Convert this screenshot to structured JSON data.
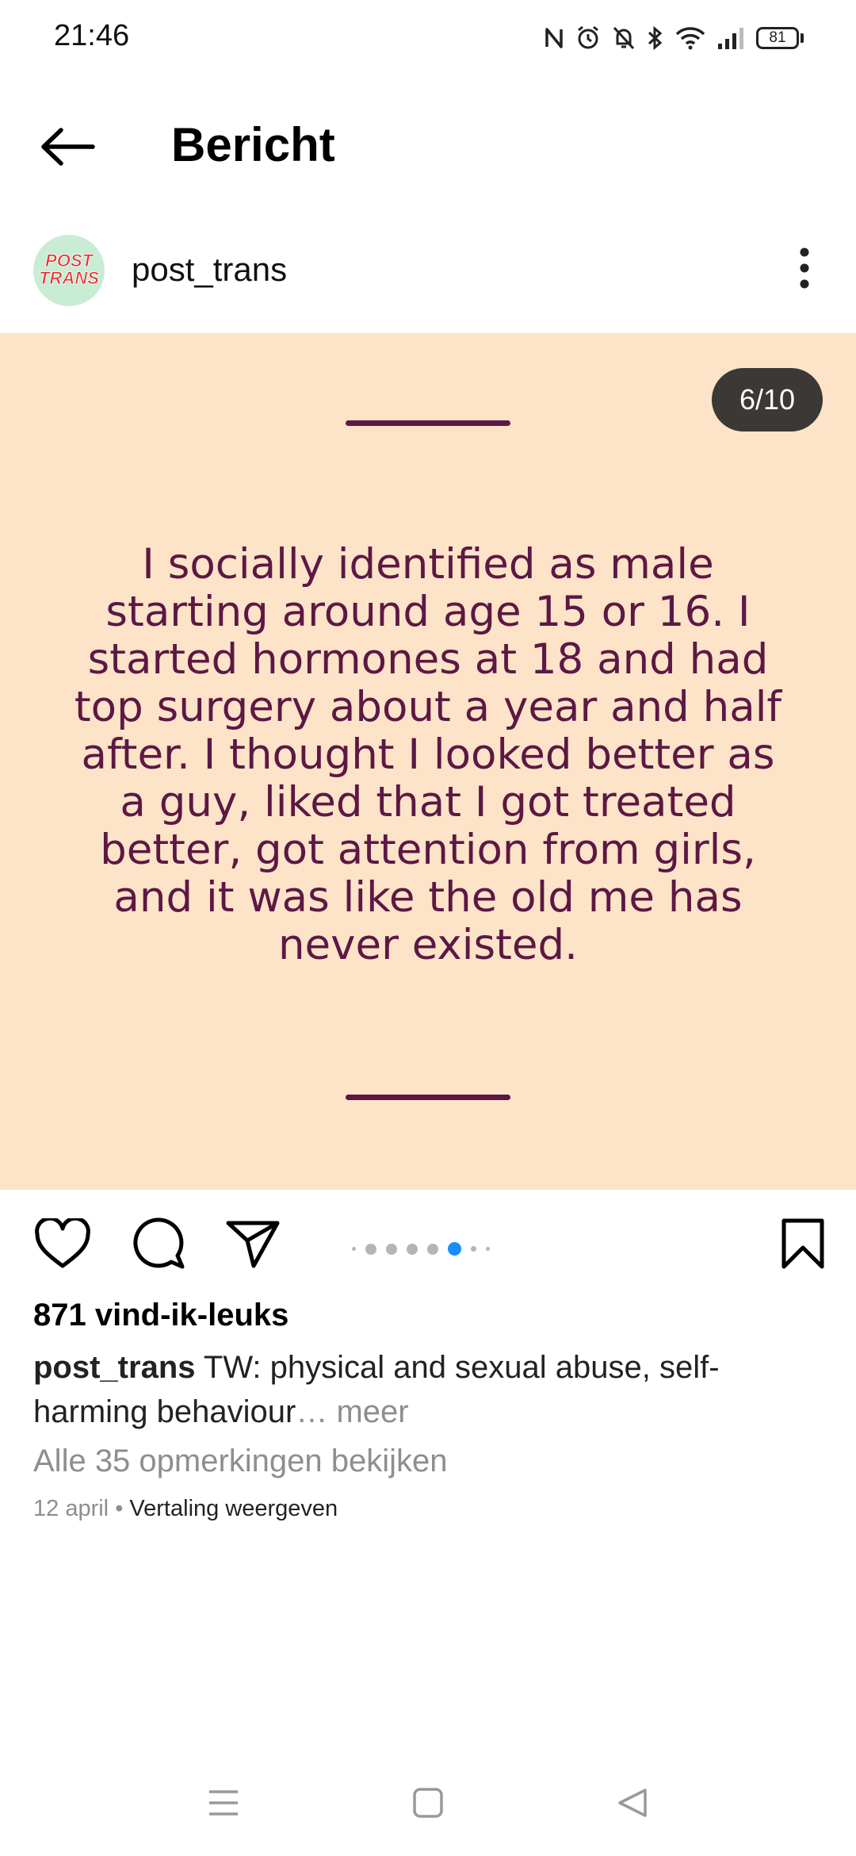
{
  "status_bar": {
    "time": "21:46",
    "battery": "81",
    "icons": [
      "nfc-icon",
      "alarm-icon",
      "bell-muted-icon",
      "bluetooth-icon",
      "wifi-icon",
      "signal-icon",
      "battery-icon"
    ]
  },
  "header": {
    "title": "Bericht",
    "back_icon": "arrow-left-icon"
  },
  "post": {
    "author": "post_trans",
    "avatar_text_line1": "POST",
    "avatar_text_line2": "TRANS",
    "more_icon": "more-vertical-icon",
    "slide": {
      "counter": "6/10",
      "text": "I socially identified as male starting around age 15 or 16. I started hormones at 18 and had top surgery about a year and half after. I thought I looked better as a guy, liked that I got treated better, got attention from girls, and it was like the old me has never existed.",
      "background": "#fde3c8",
      "text_color": "#5c1844"
    },
    "carousel": {
      "current": 6,
      "total": 10
    },
    "likes": "871 vind-ik-leuks",
    "caption_user": "post_trans",
    "caption_text": "TW: physical and sexual abuse, self-harming behaviour",
    "caption_ellipsis": "…",
    "caption_more": "meer",
    "comments_link": "Alle 35 opmerkingen bekijken",
    "date": "12 april",
    "separator": "•",
    "translate": "Vertaling weergeven"
  },
  "colors": {
    "accent": "#1a8cff",
    "muted": "#8e8e8e"
  }
}
